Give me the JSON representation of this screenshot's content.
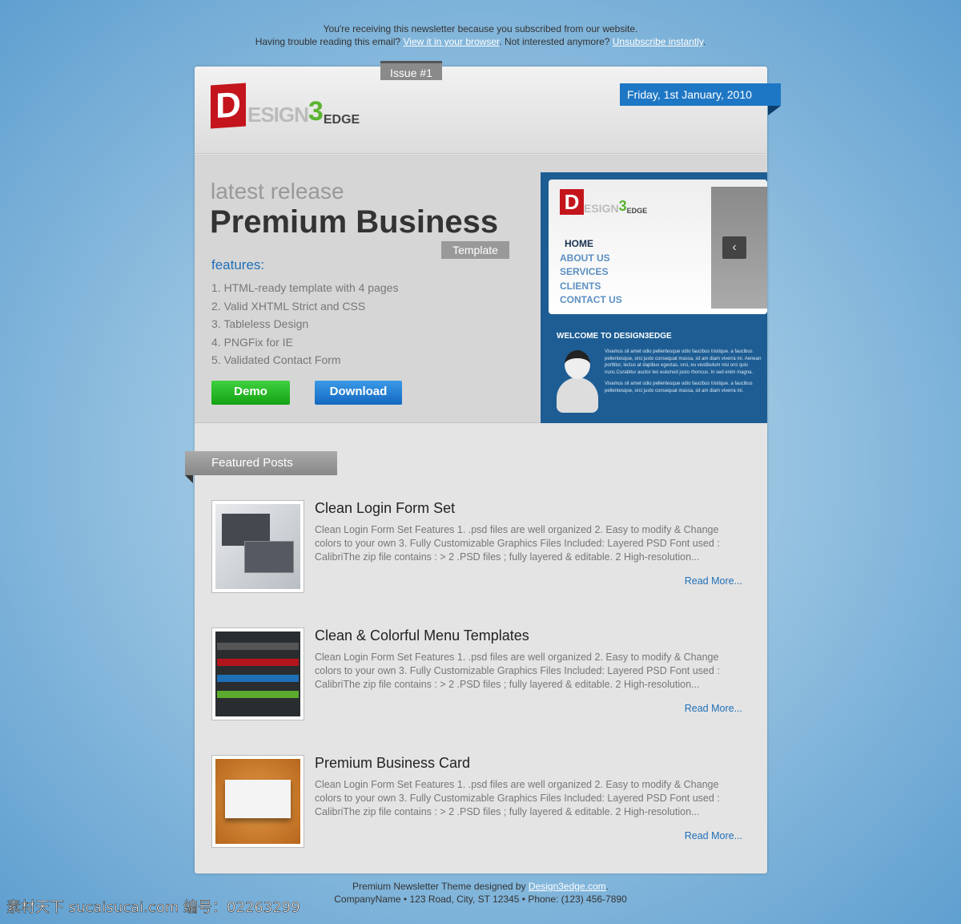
{
  "preheader": {
    "line1": "You're receiving this newsletter because you subscribed from our website.",
    "line2_a": "Having trouble reading this email?",
    "view_link": "View it in your browser",
    "line2_b": ". Not interested anymore?",
    "unsub_link": "Unsubscribe instantly",
    "line2_c": "."
  },
  "header": {
    "issue": "Issue #1",
    "logo": "Design3Edge",
    "date": "Friday, 1st January, 2010"
  },
  "hero": {
    "kicker": "latest release",
    "title": "Premium Business",
    "tag": "Template",
    "features_label": "features:",
    "features": [
      "1. HTML-ready template with 4 pages",
      "2. Valid XHTML Strict and CSS",
      "3. Tableless Design",
      "4. PNGFix for IE",
      "5. Validated Contact Form"
    ],
    "demo_label": "Demo",
    "download_label": "Download"
  },
  "preview": {
    "nav": [
      "HOME",
      "ABOUT US",
      "SERVICES",
      "CLIENTS",
      "CONTACT US"
    ],
    "welcome": "WELCOME TO DESIGN3EDGE",
    "text1": "Vivamus sit amet odio pellentesque odio faucibus tristique. a faucibus pellentesque, orci justo consequat massa, sit am diam viverra mi. Aenean porttitor, lectus at dapibus egestas, orci, eu vestibulum nisi orci quis nunc.Curabitur auctor leo euismod justo rhoncus. In sed enim magna.",
    "text2": "Vivamus sit amet odio pellentesque odio faucibus tristique. a faucibus pellentesque, orci justo consequat massa, sit am diam viverra mi."
  },
  "featured": {
    "label": "Featured Posts",
    "posts": [
      {
        "title": "Clean Login Form Set",
        "body": "Clean Login Form Set Features 1. .psd files are well organized 2. Easy to modify & Change colors to your own 3. Fully Customizable Graphics Files Included: Layered PSD Font used : CalibriThe zip file contains : > 2 .PSD files ; fully layered & editable. 2 High-resolution...",
        "read_more": "Read More..."
      },
      {
        "title": "Clean & Colorful Menu Templates",
        "body": "Clean Login Form Set Features 1. .psd files are well organized 2. Easy to modify & Change colors to your own 3. Fully Customizable Graphics Files Included: Layered PSD Font used : CalibriThe zip file contains : > 2 .PSD files ; fully layered & editable. 2 High-resolution...",
        "read_more": "Read More..."
      },
      {
        "title": "Premium Business Card",
        "body": "Clean Login Form Set Features 1. .psd files are well organized 2. Easy to modify & Change colors to your own 3. Fully Customizable Graphics Files Included: Layered PSD Font used : CalibriThe zip file contains : > 2 .PSD files ; fully layered & editable. 2 High-resolution...",
        "read_more": "Read More..."
      }
    ]
  },
  "footer": {
    "line1": "Premium Newsletter Theme designed by",
    "link": "Design3edge.com",
    "line2": "CompanyName • 123 Road, City, ST 12345 • Phone: (123) 456-7890"
  },
  "watermark": "素材天下 sucaisucai.com  编号：02263299",
  "colors": {
    "accent": "#1f6fb7",
    "brand_red": "#c4151c",
    "demo_green": "#1fb31f"
  }
}
